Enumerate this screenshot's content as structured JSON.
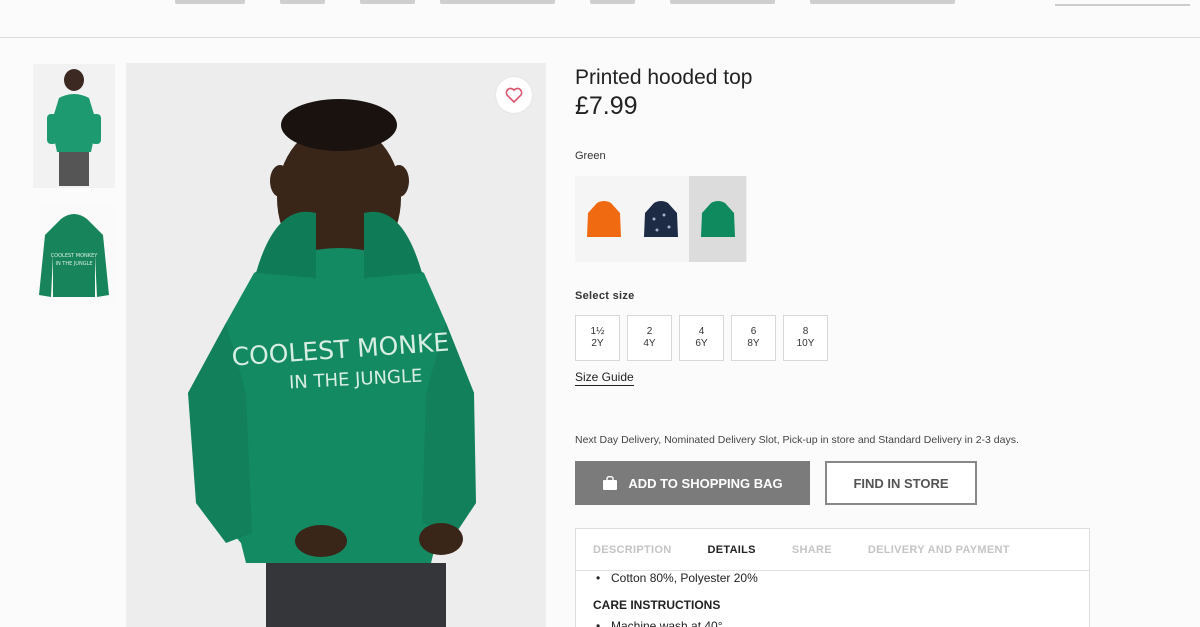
{
  "product": {
    "title": "Printed hooded top",
    "price": "£7.99",
    "color_label": "Green",
    "swatches": [
      {
        "name": "orange",
        "color": "#f06a12"
      },
      {
        "name": "navy",
        "color": "#1e2b45"
      },
      {
        "name": "green",
        "color": "#0f8a5f",
        "selected": true
      }
    ],
    "size_label": "Select size",
    "sizes": [
      {
        "top": "1½",
        "bottom": "2Y"
      },
      {
        "top": "2",
        "bottom": "4Y"
      },
      {
        "top": "4",
        "bottom": "6Y"
      },
      {
        "top": "6",
        "bottom": "8Y"
      },
      {
        "top": "8",
        "bottom": "10Y"
      }
    ],
    "size_guide": "Size Guide",
    "delivery_text": "Next Day Delivery, Nominated Delivery Slot, Pick-up in store and Standard Delivery in 2-3 days.",
    "add_to_bag": "ADD TO SHOPPING BAG",
    "find_in_store": "FIND IN STORE"
  },
  "info": {
    "tabs": [
      "DESCRIPTION",
      "DETAILS",
      "SHARE",
      "DELIVERY AND PAYMENT"
    ],
    "active_tab": "DETAILS",
    "composition": "Cotton 80%, Polyester 20%",
    "care_title": "CARE INSTRUCTIONS",
    "care_item": "Machine wash at 40°"
  },
  "colors": {
    "hoodie_green": "#138a62",
    "button_grey": "#7b7b7b"
  }
}
